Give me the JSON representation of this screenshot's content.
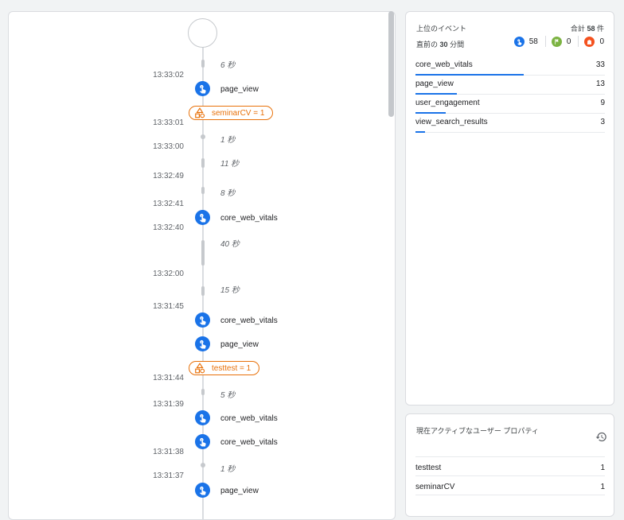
{
  "timeline": {
    "items": [
      {
        "kind": "dur",
        "text": "6 秒"
      },
      {
        "kind": "time",
        "text": "13:33:02"
      },
      {
        "kind": "event",
        "text": "page_view"
      },
      {
        "kind": "conv",
        "text": "seminarCV = 1"
      },
      {
        "kind": "time",
        "text": "13:33:01"
      },
      {
        "kind": "dur",
        "text": "1 秒"
      },
      {
        "kind": "time",
        "text": "13:33:00"
      },
      {
        "kind": "dur",
        "text": "11 秒"
      },
      {
        "kind": "time",
        "text": "13:32:49"
      },
      {
        "kind": "dur",
        "text": "8 秒"
      },
      {
        "kind": "time",
        "text": "13:32:41"
      },
      {
        "kind": "event",
        "text": "core_web_vitals"
      },
      {
        "kind": "time",
        "text": "13:32:40"
      },
      {
        "kind": "dur",
        "text": "40 秒"
      },
      {
        "kind": "time",
        "text": "13:32:00"
      },
      {
        "kind": "dur",
        "text": "15 秒"
      },
      {
        "kind": "time",
        "text": "13:31:45"
      },
      {
        "kind": "event",
        "text": "core_web_vitals"
      },
      {
        "kind": "event",
        "text": "page_view"
      },
      {
        "kind": "conv",
        "text": "testtest = 1"
      },
      {
        "kind": "time",
        "text": "13:31:44"
      },
      {
        "kind": "dur",
        "text": "5 秒"
      },
      {
        "kind": "time",
        "text": "13:31:39"
      },
      {
        "kind": "event",
        "text": "core_web_vitals"
      },
      {
        "kind": "event",
        "text": "core_web_vitals"
      },
      {
        "kind": "time",
        "text": "13:31:38"
      },
      {
        "kind": "dur",
        "text": "1 秒"
      },
      {
        "kind": "time",
        "text": "13:31:37"
      },
      {
        "kind": "event",
        "text": "page_view"
      }
    ]
  },
  "top_events": {
    "title": "上位のイベント",
    "total_prefix": "合計",
    "total_count": "58",
    "total_suffix": "件",
    "sub_prefix": "直前の",
    "sub_minutes": "30",
    "sub_suffix": "分間",
    "counts": [
      {
        "icon": "touch-icon",
        "value": "58",
        "color": "#1a73e8"
      },
      {
        "icon": "flag-icon",
        "value": "0",
        "color": "#7cb342"
      },
      {
        "icon": "shopping-bag-icon",
        "value": "0",
        "color": "#f4511e"
      }
    ],
    "rows": [
      {
        "name": "core_web_vitals",
        "value": "33",
        "fraction": 0.57
      },
      {
        "name": "page_view",
        "value": "13",
        "fraction": 0.22
      },
      {
        "name": "user_engagement",
        "value": "9",
        "fraction": 0.16
      },
      {
        "name": "view_search_results",
        "value": "3",
        "fraction": 0.05
      }
    ]
  },
  "user_props": {
    "title": "現在アクティブなユーザー プロパティ",
    "rows": [
      {
        "name": "testtest",
        "value": "1"
      },
      {
        "name": "seminarCV",
        "value": "1"
      }
    ]
  }
}
